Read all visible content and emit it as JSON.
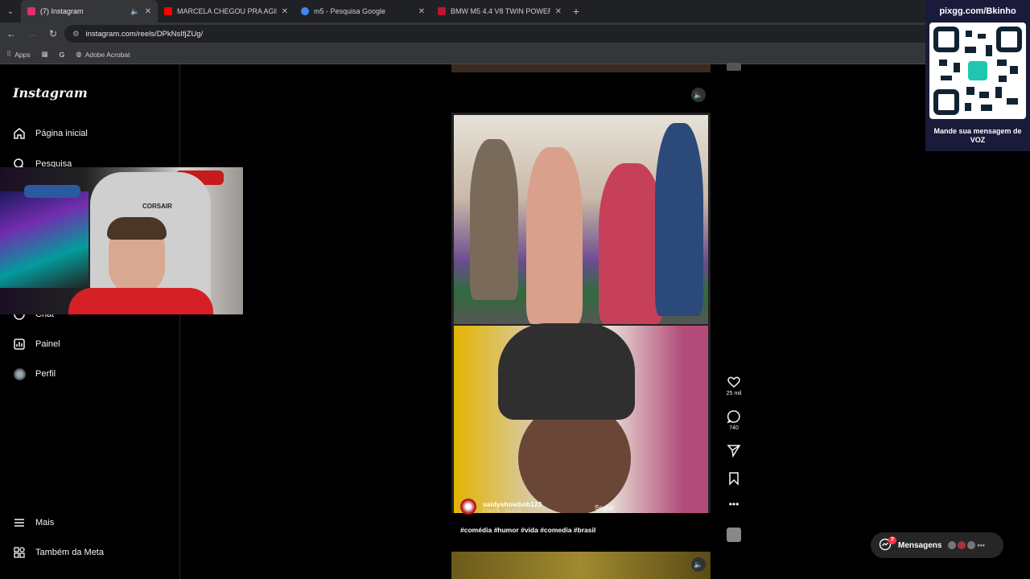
{
  "browser": {
    "tabs": [
      {
        "title": "(7) Instagram",
        "color": "#e1306c"
      },
      {
        "title": "MARCELA CHEGOU PRA AGILIZ",
        "color": "#ff0000"
      },
      {
        "title": "m5 - Pesquisa Google",
        "color": "#4285f4"
      },
      {
        "title": "BMW M5 4.4 V8 TWIN POWER",
        "color": "#c4122f"
      }
    ],
    "url": "instagram.com/reels/DPkNsIfjZUg/",
    "bookmarks": {
      "apps": "Apps",
      "acrobat": "Adobe Acrobat"
    }
  },
  "sidebar": {
    "logo": "Instagram",
    "items": [
      {
        "label": "Página inicial"
      },
      {
        "label": "Pesquisa"
      },
      {
        "label": "Chat"
      },
      {
        "label": "Painel"
      },
      {
        "label": "Perfil"
      }
    ],
    "more": "Mais",
    "meta": "Também da Meta"
  },
  "webcam": {
    "chair_brand": "CORSAIR"
  },
  "reel": {
    "username": "saidyshowbob123",
    "song": "Chezile · Beanie",
    "follow": "Seguir",
    "caption": "#comédia #humor #vida #comedia #brasil",
    "likes": "25 mil",
    "comments": "740"
  },
  "overlay": {
    "pix_title": "pixgg.com/Bkinho",
    "pix_message": "Mande sua mensagem de VOZ"
  },
  "messages": {
    "label": "Mensagens",
    "badge": "7"
  }
}
